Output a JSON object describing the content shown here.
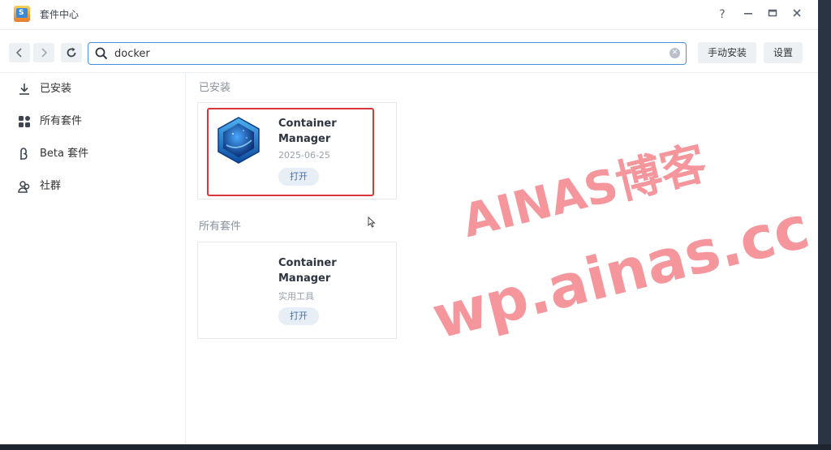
{
  "window": {
    "title": "套件中心",
    "controls": {
      "help": "?",
      "minimize": "—",
      "maximize": "▭",
      "close": "✕"
    }
  },
  "toolbar": {
    "back_icon": "chevron-left-icon",
    "forward_icon": "chevron-right-icon",
    "refresh_icon": "refresh-icon",
    "search_value": "docker",
    "manual_install_label": "手动安装",
    "settings_label": "设置"
  },
  "sidebar": {
    "items": [
      {
        "label": "已安装",
        "icon": "download-icon"
      },
      {
        "label": "所有套件",
        "icon": "grid-icon"
      },
      {
        "label": "Beta 套件",
        "icon": "beta-icon"
      },
      {
        "label": "社群",
        "icon": "community-icon"
      }
    ]
  },
  "main": {
    "installed_section": {
      "title": "已安装",
      "card": {
        "name": "Container Manager",
        "meta": "2025-06-25",
        "button_label": "打开"
      }
    },
    "all_section": {
      "title": "所有套件",
      "card": {
        "name": "Container Manager",
        "meta": "实用工具",
        "button_label": "打开"
      }
    }
  },
  "watermark": {
    "line1": "AINAS博客",
    "line2": "wp.ainas.cc"
  },
  "colors": {
    "accent": "#4a90d9",
    "highlight_border": "#d8373b",
    "watermark": "#f27882"
  }
}
